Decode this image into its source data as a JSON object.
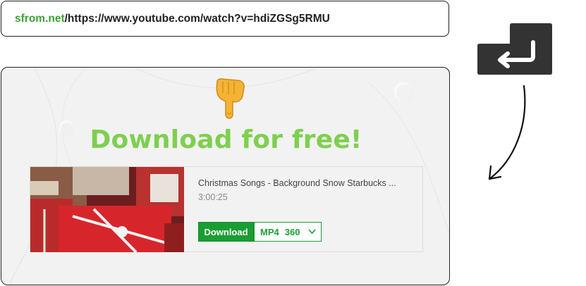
{
  "url_bar": {
    "prefix": "sfrom.net",
    "rest": "/https://www.youtube.com/watch?v=hdiZGSg5RMU"
  },
  "icons": {
    "enter_key": "enter-key-icon",
    "arrow": "curved-arrow-icon",
    "pointer": "pointing-down-hand-icon",
    "chevron": "chevron-down-icon"
  },
  "card": {
    "headline": "Download for free!",
    "video": {
      "title": "Christmas Songs - Background Snow Starbucks ...",
      "duration": "3:00:25"
    },
    "download_label": "Download",
    "format": "MP4",
    "quality": "360"
  },
  "colors": {
    "green_prefix": "#3aa335",
    "headline": "#7ed04f",
    "button": "#1a9e32",
    "card_bg": "#f2f2f2",
    "key_bg": "#333333"
  }
}
